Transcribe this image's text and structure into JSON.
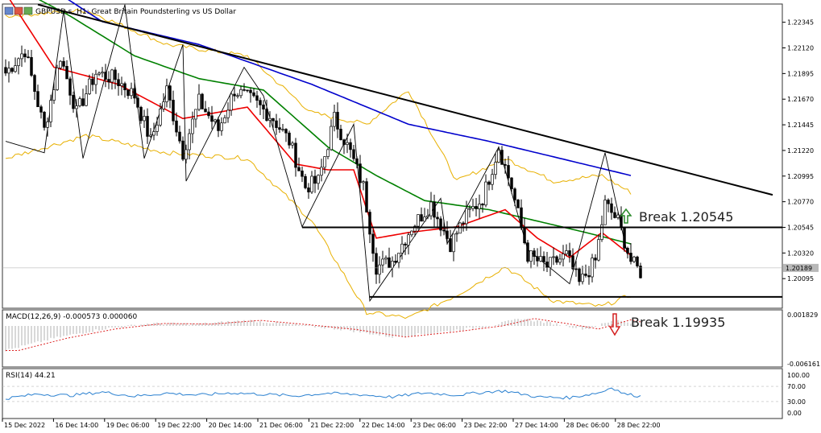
{
  "chart_data": [
    {
      "type": "candlestick",
      "title": "GBPUSD.s, H1:  Great Britain Poundsterling vs US Dollar",
      "price_ticks": [
        "1.22345",
        "1.22120",
        "1.21895",
        "1.21670",
        "1.21445",
        "1.21220",
        "1.20995",
        "1.20770",
        "1.20545",
        "1.20320",
        "1.20095"
      ],
      "ylim": [
        1.19835,
        1.22505
      ],
      "current_price": "1.20189",
      "x_labels": [
        "15 Dec 2022",
        "16 Dec 14:00",
        "19 Dec 06:00",
        "19 Dec 22:00",
        "20 Dec 14:00",
        "21 Dec 06:00",
        "21 Dec 22:00",
        "22 Dec 14:00",
        "23 Dec 06:00",
        "23 Dec 22:00",
        "27 Dec 14:00",
        "28 Dec 06:00",
        "28 Dec 22:00"
      ],
      "annotations": [
        {
          "text": "Break 1.20545",
          "level": 1.20545,
          "arrow": "up"
        },
        {
          "text": "Break 1.19935",
          "level": 1.19935,
          "arrow": "down"
        }
      ],
      "trendline": {
        "from_bar": 10,
        "from_price": 1.225,
        "to_bar": 238,
        "to_price": 1.2083
      },
      "support_lines": [
        1.20545,
        1.19935
      ],
      "close_anchors": [
        [
          0,
          1.219
        ],
        [
          6,
          1.221
        ],
        [
          12,
          1.214
        ],
        [
          17,
          1.2205
        ],
        [
          22,
          1.2155
        ],
        [
          28,
          1.219
        ],
        [
          34,
          1.2185
        ],
        [
          40,
          1.217
        ],
        [
          45,
          1.213
        ],
        [
          50,
          1.2175
        ],
        [
          55,
          1.212
        ],
        [
          60,
          1.2165
        ],
        [
          66,
          1.214
        ],
        [
          71,
          1.2175
        ],
        [
          77,
          1.2165
        ],
        [
          83,
          1.215
        ],
        [
          88,
          1.213
        ],
        [
          93,
          1.209
        ],
        [
          97,
          1.2095
        ],
        [
          102,
          1.215
        ],
        [
          107,
          1.212
        ],
        [
          111,
          1.209
        ],
        [
          115,
          1.202
        ],
        [
          120,
          1.2025
        ],
        [
          126,
          1.2055
        ],
        [
          132,
          1.2075
        ],
        [
          138,
          1.204
        ],
        [
          143,
          1.2065
        ],
        [
          148,
          1.208
        ],
        [
          153,
          1.2125
        ],
        [
          157,
          1.209
        ],
        [
          162,
          1.203
        ],
        [
          168,
          1.202
        ],
        [
          174,
          1.203
        ],
        [
          178,
          1.2005
        ],
        [
          183,
          1.2025
        ],
        [
          186,
          1.2075
        ],
        [
          190,
          1.206
        ],
        [
          194,
          1.2025
        ],
        [
          197,
          1.2015
        ]
      ],
      "ma_series": [
        {
          "color": "#0000cc",
          "anchors": [
            [
              0,
              1.229
            ],
            [
              30,
              1.2235
            ],
            [
              60,
              1.2215
            ],
            [
              95,
              1.218
            ],
            [
              125,
              1.2145
            ],
            [
              150,
              1.213
            ],
            [
              175,
              1.2113
            ],
            [
              194,
              1.21
            ]
          ]
        },
        {
          "color": "#008000",
          "anchors": [
            [
              0,
              1.227
            ],
            [
              20,
              1.224
            ],
            [
              40,
              1.2205
            ],
            [
              60,
              1.2185
            ],
            [
              80,
              1.2175
            ],
            [
              100,
              1.2125
            ],
            [
              115,
              1.21
            ],
            [
              130,
              1.2078
            ],
            [
              150,
              1.207
            ],
            [
              165,
              1.206
            ],
            [
              180,
              1.205
            ],
            [
              194,
              1.204
            ]
          ]
        },
        {
          "color": "#ee0000",
          "anchors": [
            [
              0,
              1.226
            ],
            [
              15,
              1.2195
            ],
            [
              35,
              1.218
            ],
            [
              55,
              1.215
            ],
            [
              75,
              1.216
            ],
            [
              90,
              1.211
            ],
            [
              100,
              1.2105
            ],
            [
              108,
              1.2105
            ],
            [
              115,
              1.2045
            ],
            [
              125,
              1.205
            ],
            [
              140,
              1.2055
            ],
            [
              155,
              1.207
            ],
            [
              165,
              1.2045
            ],
            [
              175,
              1.2028
            ],
            [
              185,
              1.205
            ],
            [
              194,
              1.203
            ]
          ]
        },
        {
          "color": "#e8b000",
          "anchors": [
            [
              0,
              1.224
            ],
            [
              25,
              1.2245
            ],
            [
              50,
              1.2215
            ],
            [
              75,
              1.2205
            ],
            [
              95,
              1.2155
            ],
            [
              112,
              1.2145
            ],
            [
              125,
              1.2175
            ],
            [
              140,
              1.2095
            ],
            [
              155,
              1.2115
            ],
            [
              170,
              1.2095
            ],
            [
              185,
              1.21
            ],
            [
              194,
              1.2085
            ]
          ]
        },
        {
          "color": "#e8b000",
          "anchors": [
            [
              0,
              1.2115
            ],
            [
              25,
              1.2135
            ],
            [
              50,
              1.212
            ],
            [
              75,
              1.2115
            ],
            [
              95,
              1.206
            ],
            [
              112,
              1.198
            ],
            [
              125,
              1.1975
            ],
            [
              140,
              1.1995
            ],
            [
              155,
              1.202
            ],
            [
              170,
              1.199
            ],
            [
              185,
              1.1985
            ],
            [
              194,
              1.1995
            ]
          ]
        }
      ],
      "macd": {
        "label": "MACD(12,26,9) -0.000573 0.000060",
        "ticks": [
          "0.001829",
          "-0.006161"
        ],
        "anchors": [
          [
            0,
            -0.004
          ],
          [
            15,
            -0.002
          ],
          [
            30,
            -0.0005
          ],
          [
            45,
            0.0004
          ],
          [
            60,
            0.0003
          ],
          [
            75,
            0.0009
          ],
          [
            90,
            0.0002
          ],
          [
            105,
            -0.0006
          ],
          [
            120,
            -0.0018
          ],
          [
            135,
            -0.001
          ],
          [
            150,
            0.0
          ],
          [
            160,
            0.0012
          ],
          [
            170,
            0.0004
          ],
          [
            180,
            -0.0005
          ],
          [
            190,
            0.001
          ],
          [
            197,
            0.0002
          ]
        ]
      },
      "rsi": {
        "label": "RSI(14) 44.21",
        "ticks": [
          "100.00",
          "70.00",
          "30.00",
          "0.00"
        ],
        "anchors": [
          [
            0,
            38
          ],
          [
            10,
            50
          ],
          [
            20,
            46
          ],
          [
            30,
            55
          ],
          [
            40,
            44
          ],
          [
            50,
            52
          ],
          [
            60,
            47
          ],
          [
            70,
            53
          ],
          [
            80,
            49
          ],
          [
            90,
            45
          ],
          [
            100,
            52
          ],
          [
            110,
            48
          ],
          [
            120,
            42
          ],
          [
            130,
            53
          ],
          [
            140,
            47
          ],
          [
            150,
            56
          ],
          [
            155,
            58
          ],
          [
            165,
            42
          ],
          [
            175,
            40
          ],
          [
            185,
            55
          ],
          [
            188,
            68
          ],
          [
            192,
            50
          ],
          [
            197,
            44
          ]
        ]
      }
    }
  ]
}
